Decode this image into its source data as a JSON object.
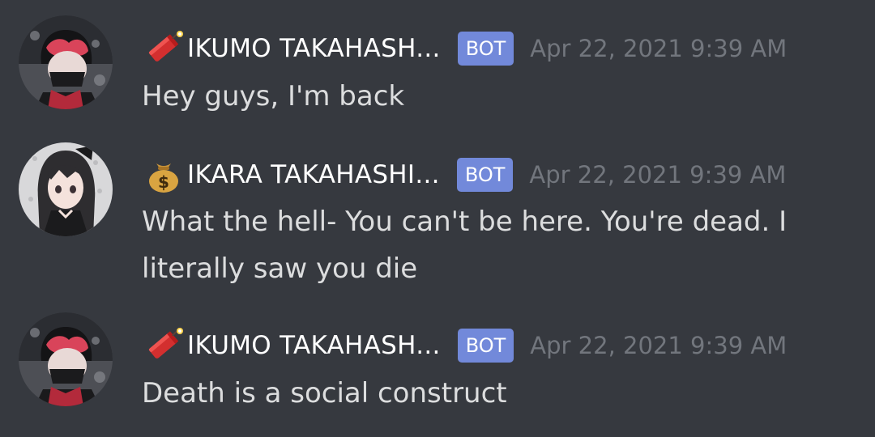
{
  "messages": [
    {
      "author": "IKUMO TAKAHASH...",
      "emoji": "firecracker-icon",
      "tag": "BOT",
      "timestamp": "Apr 22, 2021 9:39 AM",
      "text": "Hey guys, I'm back"
    },
    {
      "author": "IKARA TAKAHASHI...",
      "emoji": "money-bag-icon",
      "tag": "BOT",
      "timestamp": "Apr 22, 2021 9:39 AM",
      "text": "What the hell- You can't be here. You're dead. I literally saw you die"
    },
    {
      "author": "IKUMO TAKAHASH...",
      "emoji": "firecracker-icon",
      "tag": "BOT",
      "timestamp": "Apr 22, 2021 9:39 AM",
      "text": "Death is a social construct"
    }
  ],
  "colors": {
    "background": "#36393f",
    "username": "#ffffff",
    "bot_tag": "#7289da",
    "timestamp": "#72767d",
    "message_text": "#dcddde"
  }
}
